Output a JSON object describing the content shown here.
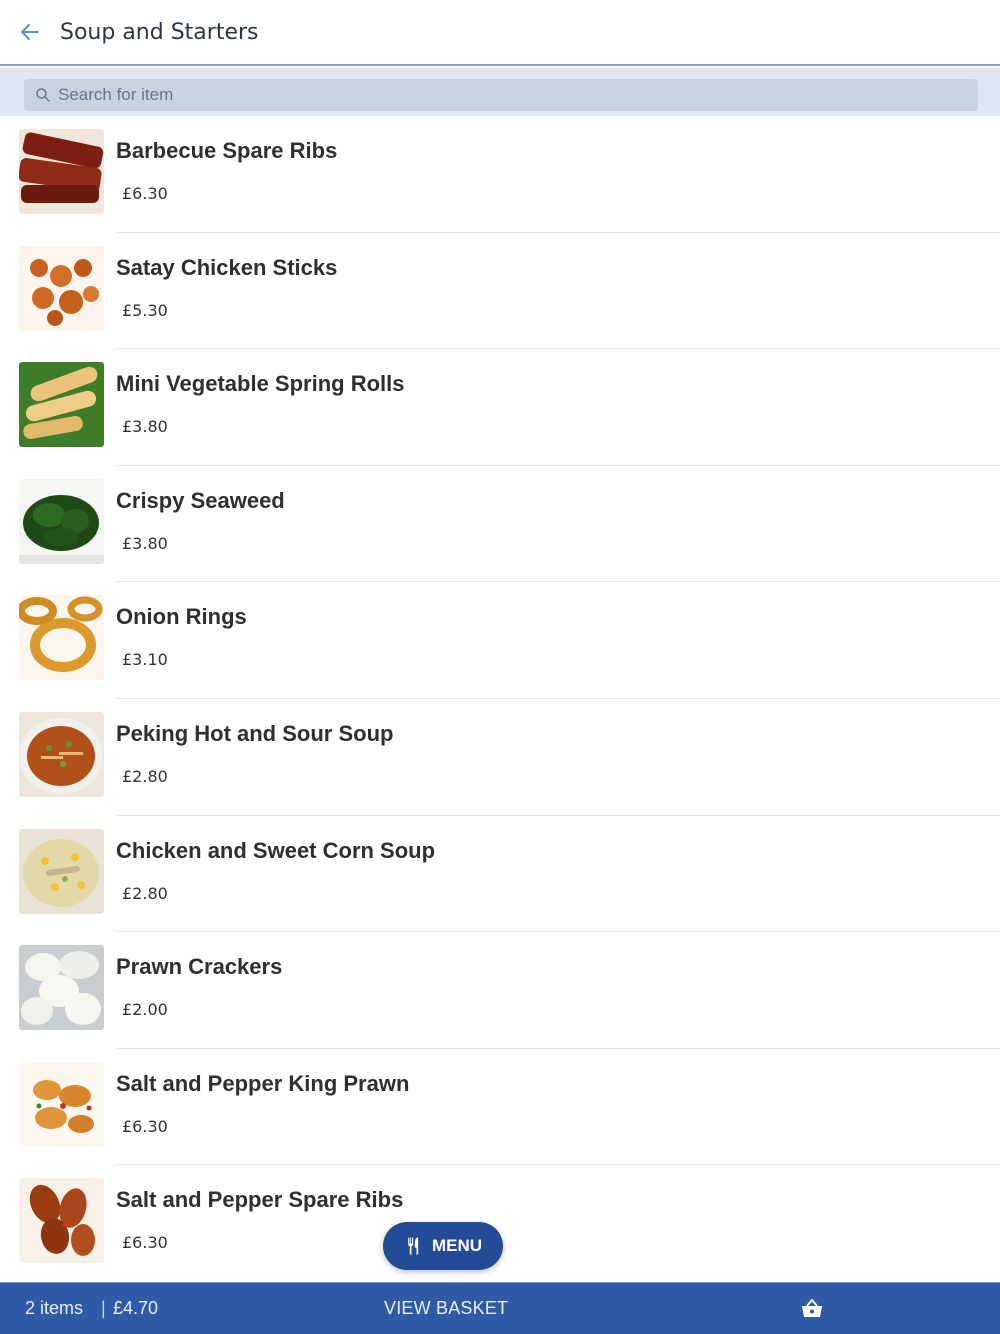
{
  "header": {
    "title": "Soup and Starters",
    "back_icon": "arrow-left-icon"
  },
  "search": {
    "placeholder": "Search for item",
    "value": ""
  },
  "items": [
    {
      "name": "Barbecue Spare Ribs",
      "price": "£6.30"
    },
    {
      "name": "Satay Chicken Sticks",
      "price": "£5.30"
    },
    {
      "name": "Mini Vegetable Spring Rolls",
      "price": "£3.80"
    },
    {
      "name": "Crispy Seaweed",
      "price": "£3.80"
    },
    {
      "name": "Onion Rings",
      "price": "£3.10"
    },
    {
      "name": "Peking Hot and Sour Soup",
      "price": "£2.80"
    },
    {
      "name": "Chicken and Sweet Corn Soup",
      "price": "£2.80"
    },
    {
      "name": "Prawn Crackers",
      "price": "£2.00"
    },
    {
      "name": "Salt and Pepper King Prawn",
      "price": "£6.30"
    },
    {
      "name": "Salt and Pepper Spare Ribs",
      "price": "£6.30"
    }
  ],
  "menu_button": {
    "label": "MENU",
    "icon": "fork-knife-icon"
  },
  "basket_bar": {
    "count": "2 items",
    "separator": "|",
    "total": "£4.70",
    "view_label": "VIEW BASKET",
    "icon": "basket-icon"
  },
  "colors": {
    "primary": "#2f5aa6",
    "menu_button": "#234b96",
    "search_bar": "#dfe7f1"
  }
}
